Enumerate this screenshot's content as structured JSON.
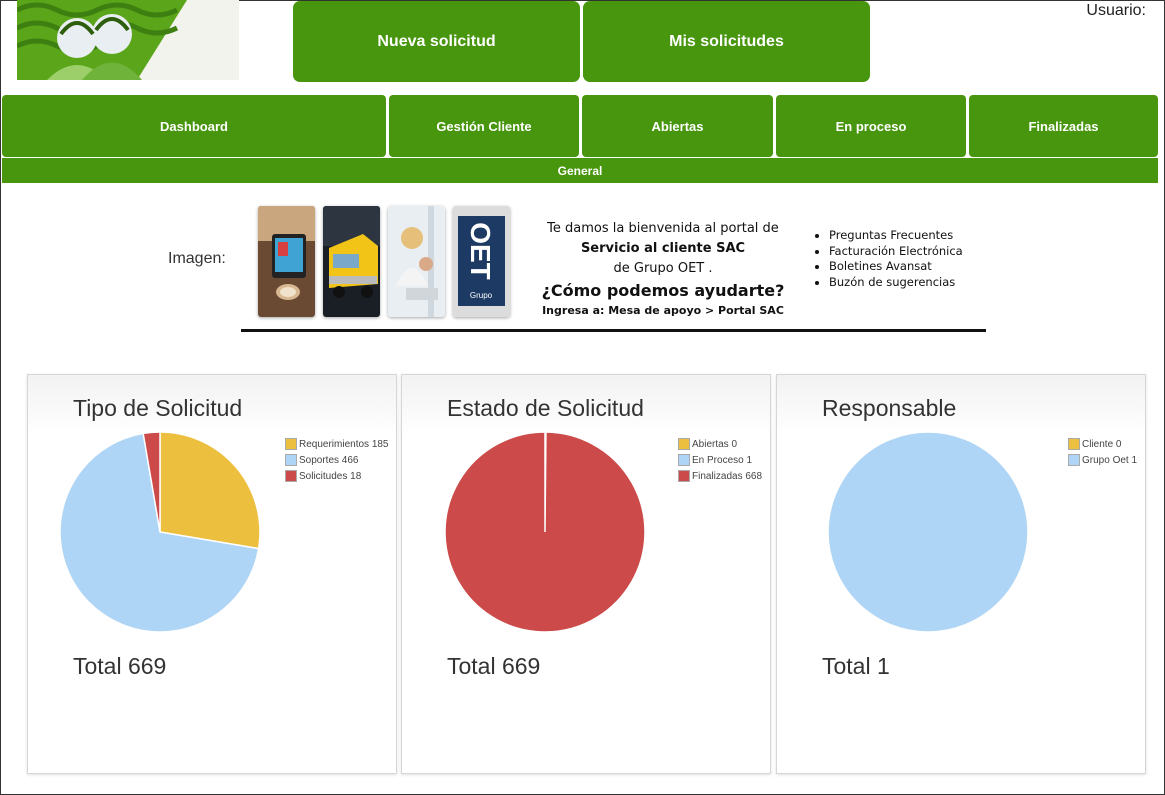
{
  "header": {
    "new_request": "Nueva solicitud",
    "my_requests": "Mis solicitudes",
    "user_label": "Usuario:"
  },
  "nav": {
    "items": [
      "Dashboard",
      "Gestión Cliente",
      "Abiertas",
      "En proceso",
      "Finalizadas"
    ],
    "general": "General"
  },
  "banner": {
    "image_label": "Imagen:",
    "welcome_line1": "Te damos la bienvenida al portal de",
    "welcome_line2": "Servicio al cliente SAC",
    "welcome_line3": "de Grupo OET .",
    "welcome_question": "¿Cómo podemos ayudarte?",
    "welcome_path": "Ingresa a: Mesa de apoyo > Portal SAC",
    "links": [
      "Preguntas Frecuentes",
      "Facturación Electrónica",
      "Boletines Avansat",
      "Buzón de sugerencias"
    ],
    "logo_text": "OET",
    "logo_subtext": "Grupo"
  },
  "colors": {
    "brand_green": "#47960e",
    "pie_yellow": "#edbf3f",
    "pie_blue": "#aed5f5",
    "pie_red": "#cc4a4a"
  },
  "chart_data": [
    {
      "type": "pie",
      "title": "Tipo de Solicitud",
      "total": "Total 669",
      "categories": [
        "Requerimientos",
        "Soportes",
        "Solicitudes"
      ],
      "values": [
        185,
        466,
        18
      ],
      "legend_labels": [
        "Requerimientos 185",
        "Soportes 466",
        "Solicitudes 18"
      ],
      "colors": [
        "#edbf3f",
        "#aed5f5",
        "#cc4a4a"
      ],
      "legend": "right"
    },
    {
      "type": "pie",
      "title": "Estado de Solicitud",
      "total": "Total 669",
      "categories": [
        "Abiertas",
        "En Proceso",
        "Finalizadas"
      ],
      "values": [
        0,
        1,
        668
      ],
      "legend_labels": [
        "Abiertas 0",
        "En Proceso 1",
        "Finalizadas 668"
      ],
      "colors": [
        "#edbf3f",
        "#aed5f5",
        "#cc4a4a"
      ],
      "legend": "right"
    },
    {
      "type": "pie",
      "title": "Responsable",
      "total": "Total 1",
      "categories": [
        "Cliente",
        "Grupo Oet"
      ],
      "values": [
        0,
        1
      ],
      "legend_labels": [
        "Cliente 0",
        "Grupo Oet 1"
      ],
      "colors": [
        "#edbf3f",
        "#aed5f5"
      ],
      "legend": "right"
    }
  ]
}
